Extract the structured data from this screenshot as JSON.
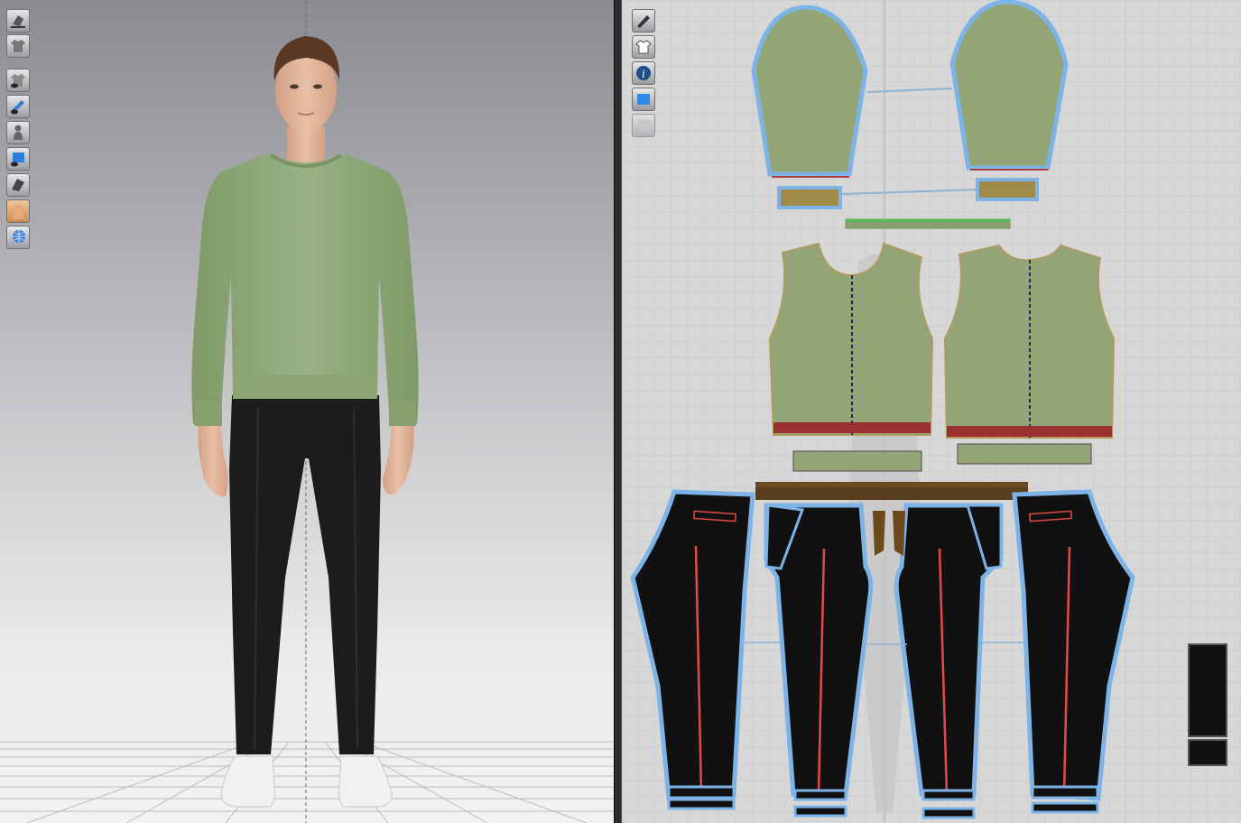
{
  "viewport_3d": {
    "toolbar": [
      {
        "icon": "garment-3d-mode-icon"
      },
      {
        "icon": "garment-shirt-icon"
      },
      {
        "icon": "show-garment-icon"
      },
      {
        "icon": "show-pins-icon"
      },
      {
        "icon": "show-avatar-icon"
      },
      {
        "icon": "show-texture-icon"
      },
      {
        "icon": "surface-display-icon"
      },
      {
        "icon": "avatar-skin-icon"
      },
      {
        "icon": "environment-globe-icon"
      }
    ],
    "colors": {
      "sweater": "#8fa878",
      "pants": "#1b1b1b",
      "skin": "#e2b79c",
      "hair": "#5a3826",
      "shoes": "#f0f0f0"
    }
  },
  "viewport_2d": {
    "toolbar": [
      {
        "icon": "2d-pattern-mode-icon"
      },
      {
        "icon": "show-garment-2d-icon"
      },
      {
        "icon": "info-icon"
      },
      {
        "icon": "show-2d-texture-icon"
      },
      {
        "icon": "locked-shirt-icon"
      }
    ],
    "colors": {
      "knit": "#93a577",
      "rib_band": "#a08a48",
      "pant": "#111111",
      "outline": "#7db3e6",
      "seam": "#e34a4a",
      "waist_band": "#5a3f1f",
      "hem_red": "#9a3030"
    },
    "pattern_pieces": [
      {
        "name": "sleeve-left"
      },
      {
        "name": "sleeve-right"
      },
      {
        "name": "cuff-left"
      },
      {
        "name": "cuff-right"
      },
      {
        "name": "neck-rib"
      },
      {
        "name": "front-body"
      },
      {
        "name": "back-body"
      },
      {
        "name": "hem-rib-front"
      },
      {
        "name": "hem-rib-back"
      },
      {
        "name": "waistband"
      },
      {
        "name": "pant-front-left"
      },
      {
        "name": "pant-back-left"
      },
      {
        "name": "pant-back-right"
      },
      {
        "name": "pant-front-right"
      },
      {
        "name": "pocket-facing-left"
      },
      {
        "name": "pocket-facing-right"
      },
      {
        "name": "fly-pieces"
      },
      {
        "name": "pocket-bag"
      }
    ]
  }
}
